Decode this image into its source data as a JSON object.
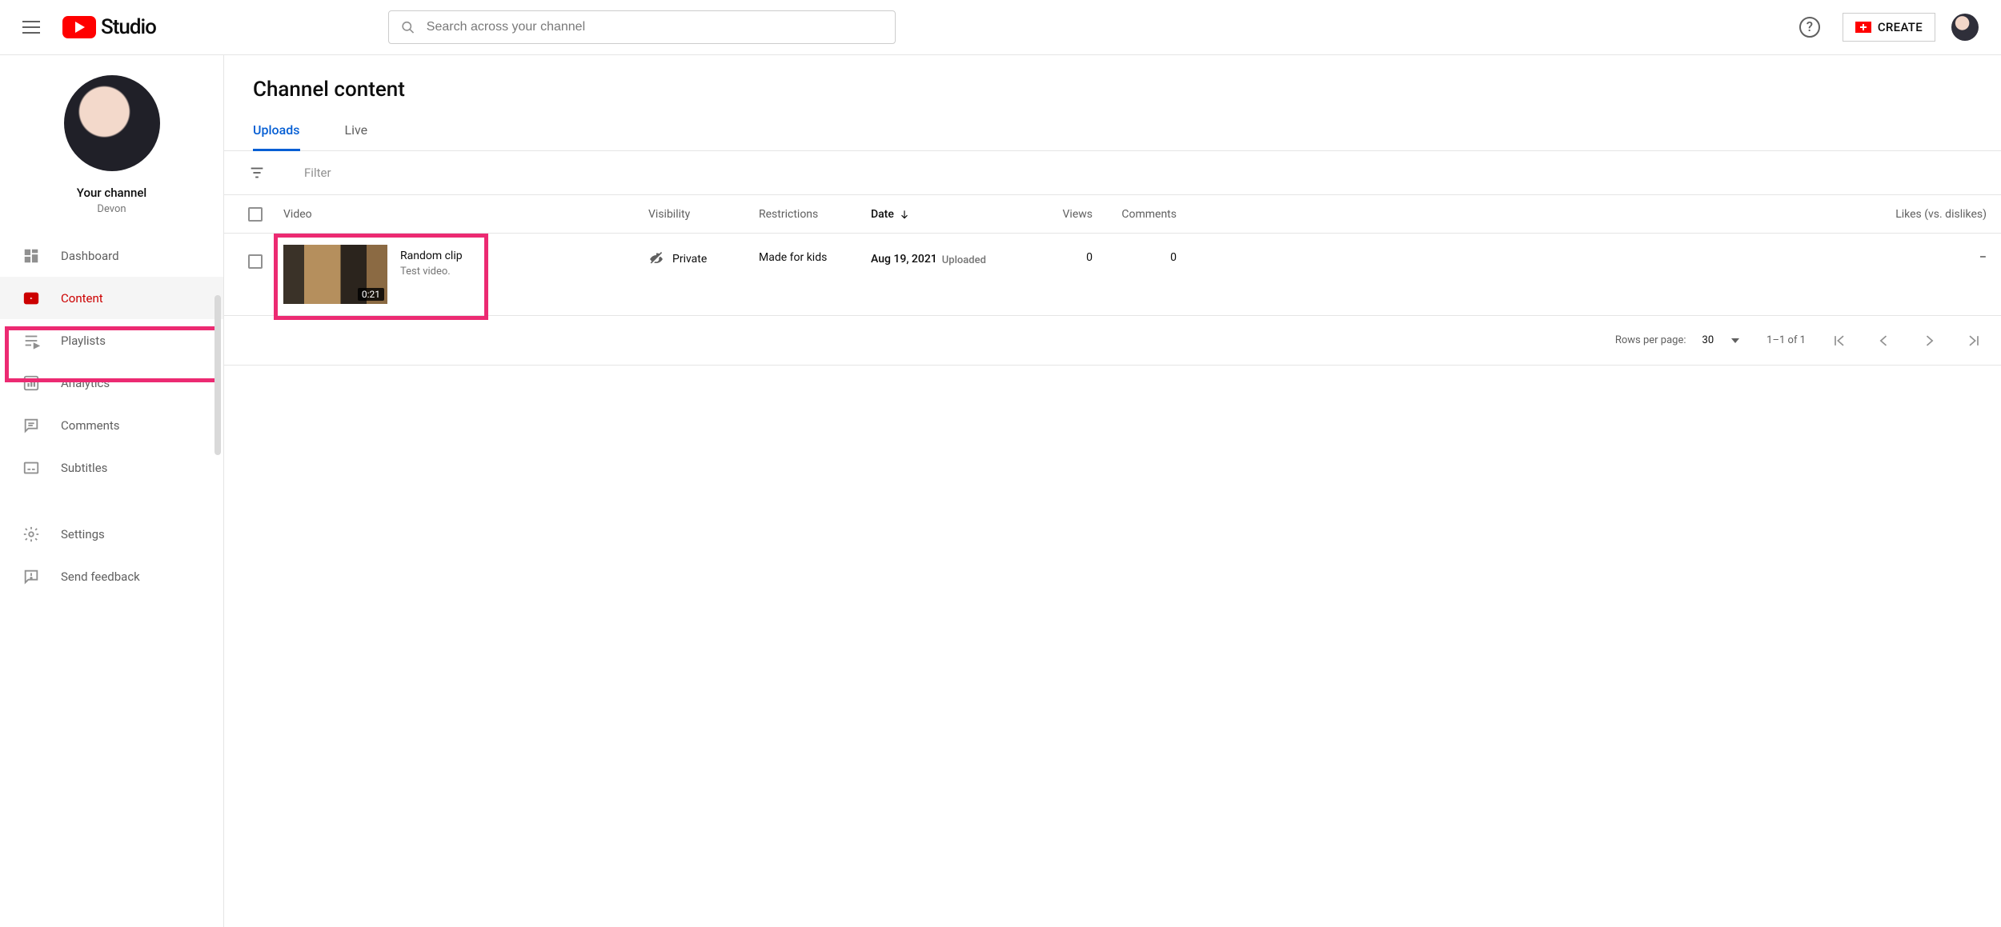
{
  "header": {
    "logo_text": "Studio",
    "search_placeholder": "Search across your channel",
    "create_label": "CREATE"
  },
  "sidebar": {
    "channel_heading": "Your channel",
    "channel_name": "Devon",
    "items": [
      {
        "label": "Dashboard"
      },
      {
        "label": "Content"
      },
      {
        "label": "Playlists"
      },
      {
        "label": "Analytics"
      },
      {
        "label": "Comments"
      },
      {
        "label": "Subtitles"
      },
      {
        "label": "Settings"
      },
      {
        "label": "Send feedback"
      }
    ]
  },
  "main": {
    "title": "Channel content",
    "tabs": [
      {
        "label": "Uploads"
      },
      {
        "label": "Live"
      }
    ],
    "filter_placeholder": "Filter",
    "columns": {
      "video": "Video",
      "visibility": "Visibility",
      "restrictions": "Restrictions",
      "date": "Date",
      "views": "Views",
      "comments": "Comments",
      "likes": "Likes (vs. dislikes)"
    },
    "rows": [
      {
        "title": "Random clip",
        "description": "Test video.",
        "duration": "0:21",
        "visibility": "Private",
        "restrictions": "Made for kids",
        "date": "Aug 19, 2021",
        "date_sub": "Uploaded",
        "views": "0",
        "comments": "0",
        "likes": "–"
      }
    ],
    "pagination": {
      "rows_per_page_label": "Rows per page:",
      "rows_per_page_value": "30",
      "range_label": "1–1 of 1"
    }
  }
}
